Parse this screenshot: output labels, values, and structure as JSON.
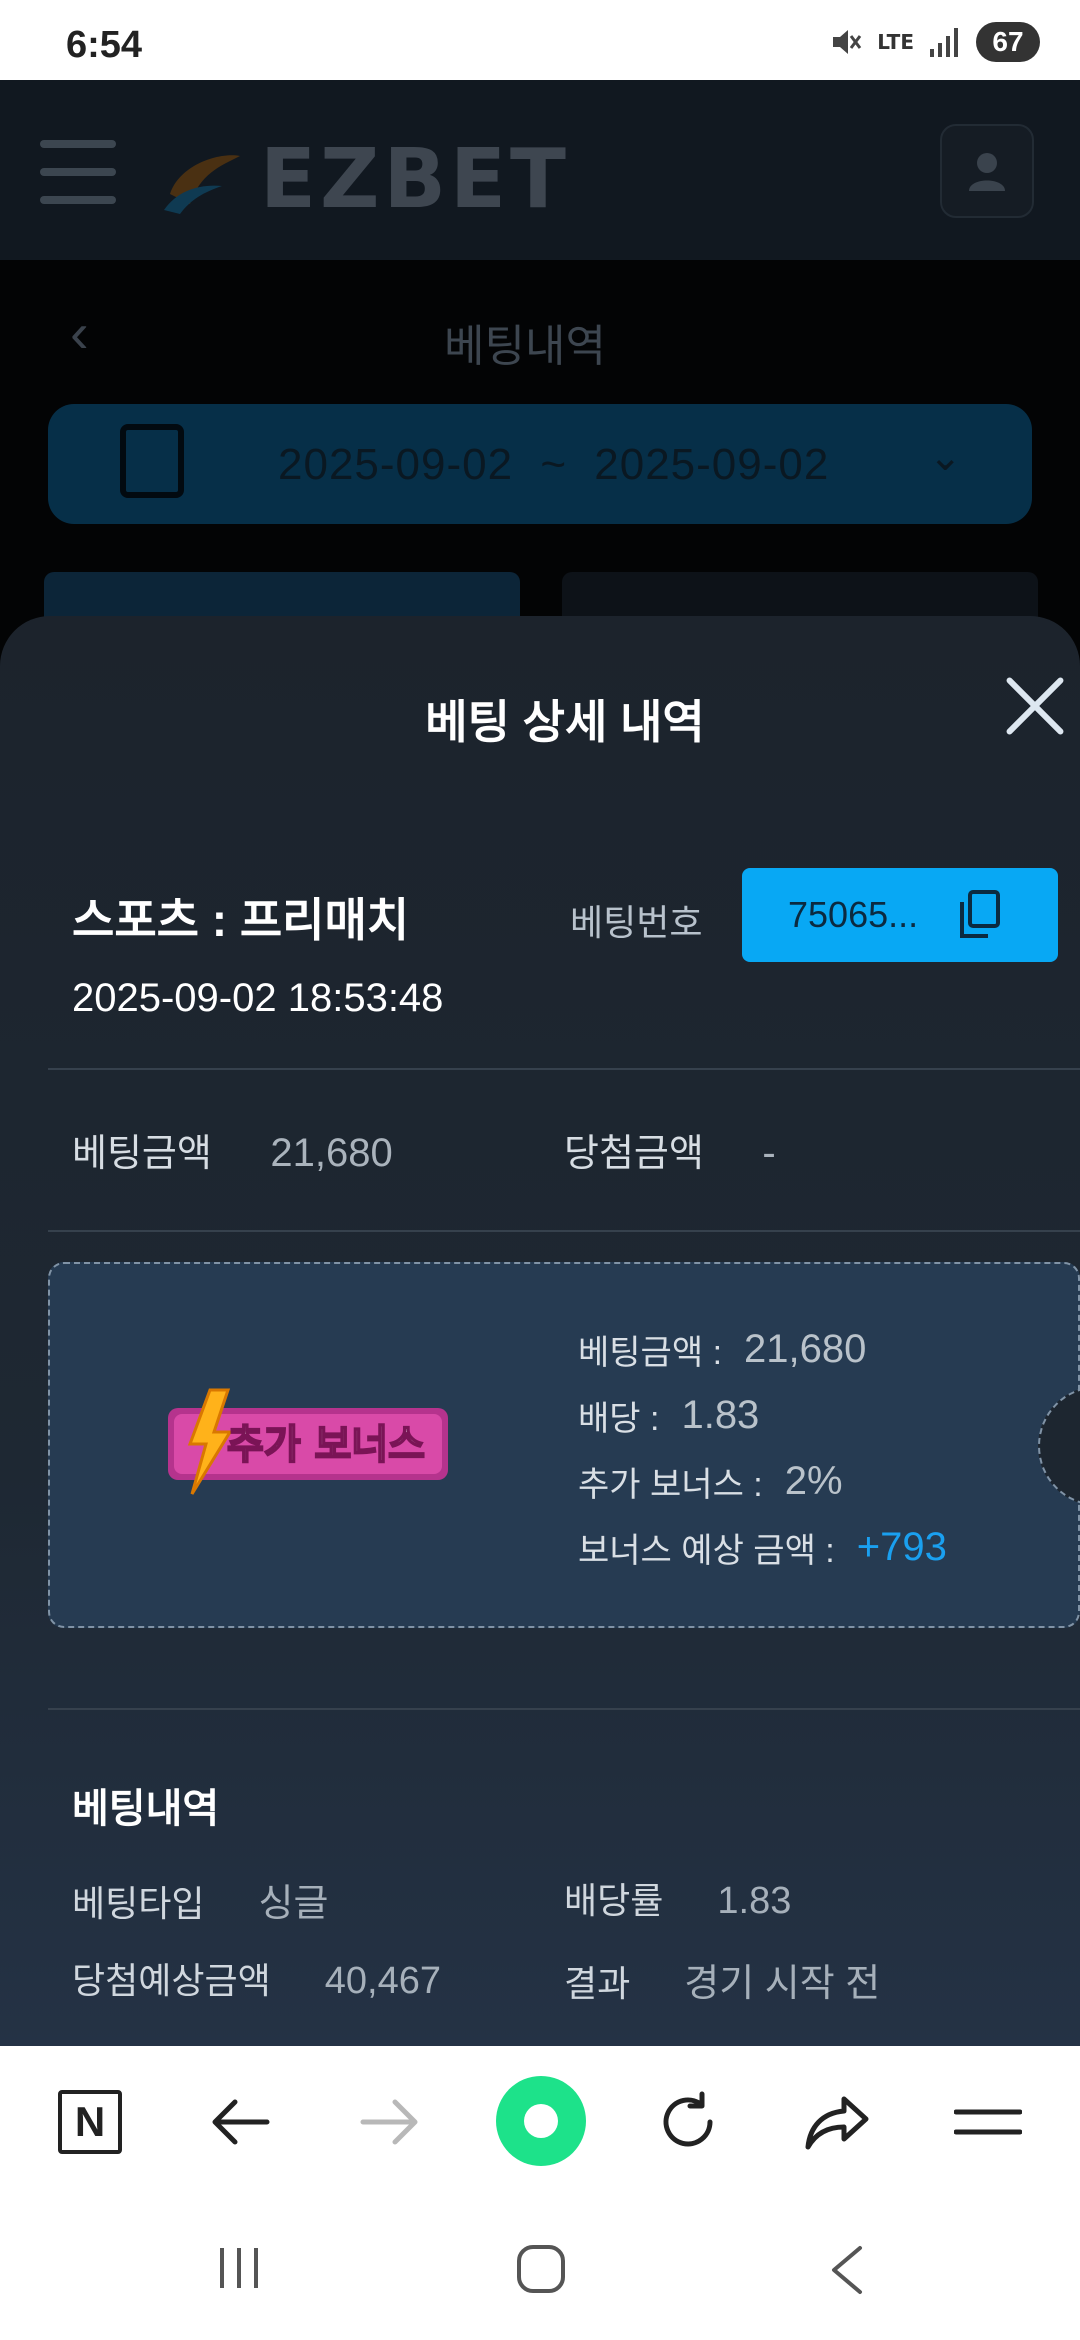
{
  "status_bar": {
    "time": "6:54",
    "network": "LTE",
    "battery": "67"
  },
  "header": {
    "logo_text": "EZBET"
  },
  "page": {
    "title": "베팅내역",
    "date_from": "2025-09-02",
    "date_separator": "~",
    "date_to": "2025-09-02"
  },
  "sheet": {
    "title": "베팅 상세 내역",
    "category": "스포츠 : 프리매치",
    "datetime": "2025-09-02 18:53:48",
    "bet_no_label": "베팅번호",
    "bet_no_value": "75065...",
    "bet_amount_label": "베팅금액",
    "bet_amount_value": "21,680",
    "win_amount_label": "당첨금액",
    "win_amount_value": "-",
    "bonus": {
      "badge_text": "추가 보너스",
      "bet_amount_label": "베팅금액 :",
      "bet_amount_value": "21,680",
      "odds_label": "배당 :",
      "odds_value": "1.83",
      "extra_label": "추가 보너스 :",
      "extra_value": "2%",
      "expected_label": "보너스 예상 금액 :",
      "expected_value": "+793"
    },
    "history": {
      "title": "베팅내역",
      "type_label": "베팅타입",
      "type_value": "싱글",
      "rate_label": "배당률",
      "rate_value": "1.83",
      "expected_label": "당첨예상금액",
      "expected_value": "40,467",
      "result_label": "결과",
      "result_value": "경기 시작 전"
    }
  },
  "browser": {
    "n_label": "N"
  },
  "colors": {
    "accent": "#08a8f4",
    "bonus_blue": "#1aa0f0",
    "sheet_bg": "#1e2833",
    "green": "#1de28a"
  }
}
